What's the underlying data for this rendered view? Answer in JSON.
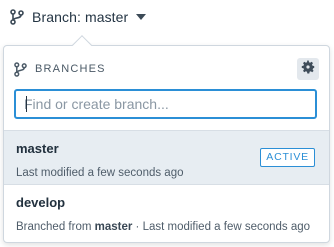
{
  "trigger": {
    "label": "Branch: master",
    "icon": "git-branch-icon",
    "caret_icon": "caret-down-icon"
  },
  "popover": {
    "title": "BRANCHES",
    "title_icon": "git-branch-icon",
    "settings_icon": "gear-icon",
    "search": {
      "placeholder": "Find or create branch...",
      "value": ""
    },
    "branches": [
      {
        "name": "master",
        "meta_prefix": "Last modified a few seconds ago",
        "meta_from": "",
        "meta_suffix": "",
        "badge": "ACTIVE",
        "active": true
      },
      {
        "name": "develop",
        "meta_prefix": "Branched from ",
        "meta_from": "master",
        "meta_suffix": " · Last modified a few seconds ago",
        "badge": "",
        "active": false
      }
    ]
  },
  "colors": {
    "accent": "#2b8fd6",
    "active_row_bg": "#e7edf2",
    "text_primary": "#22313e",
    "text_secondary": "#4f5d6a"
  }
}
